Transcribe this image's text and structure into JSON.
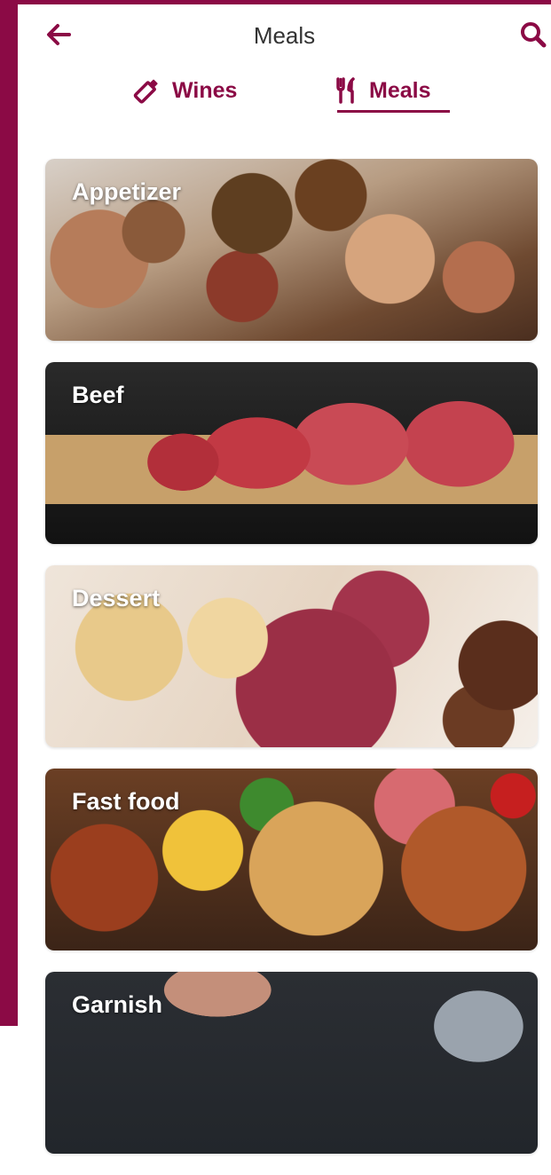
{
  "header": {
    "title": "Meals",
    "back_icon": "arrow-left-icon",
    "search_icon": "search-icon"
  },
  "tabs": [
    {
      "label": "Wines",
      "icon": "wine-bottle-icon",
      "active": false
    },
    {
      "label": "Meals",
      "icon": "fork-knife-icon",
      "active": true
    }
  ],
  "categories": [
    {
      "label": "Appetizer"
    },
    {
      "label": "Beef"
    },
    {
      "label": "Dessert"
    },
    {
      "label": "Fast food"
    },
    {
      "label": "Garnish"
    }
  ],
  "colors": {
    "accent": "#8b0a45",
    "title_text": "#333333",
    "card_label": "#ffffff"
  }
}
